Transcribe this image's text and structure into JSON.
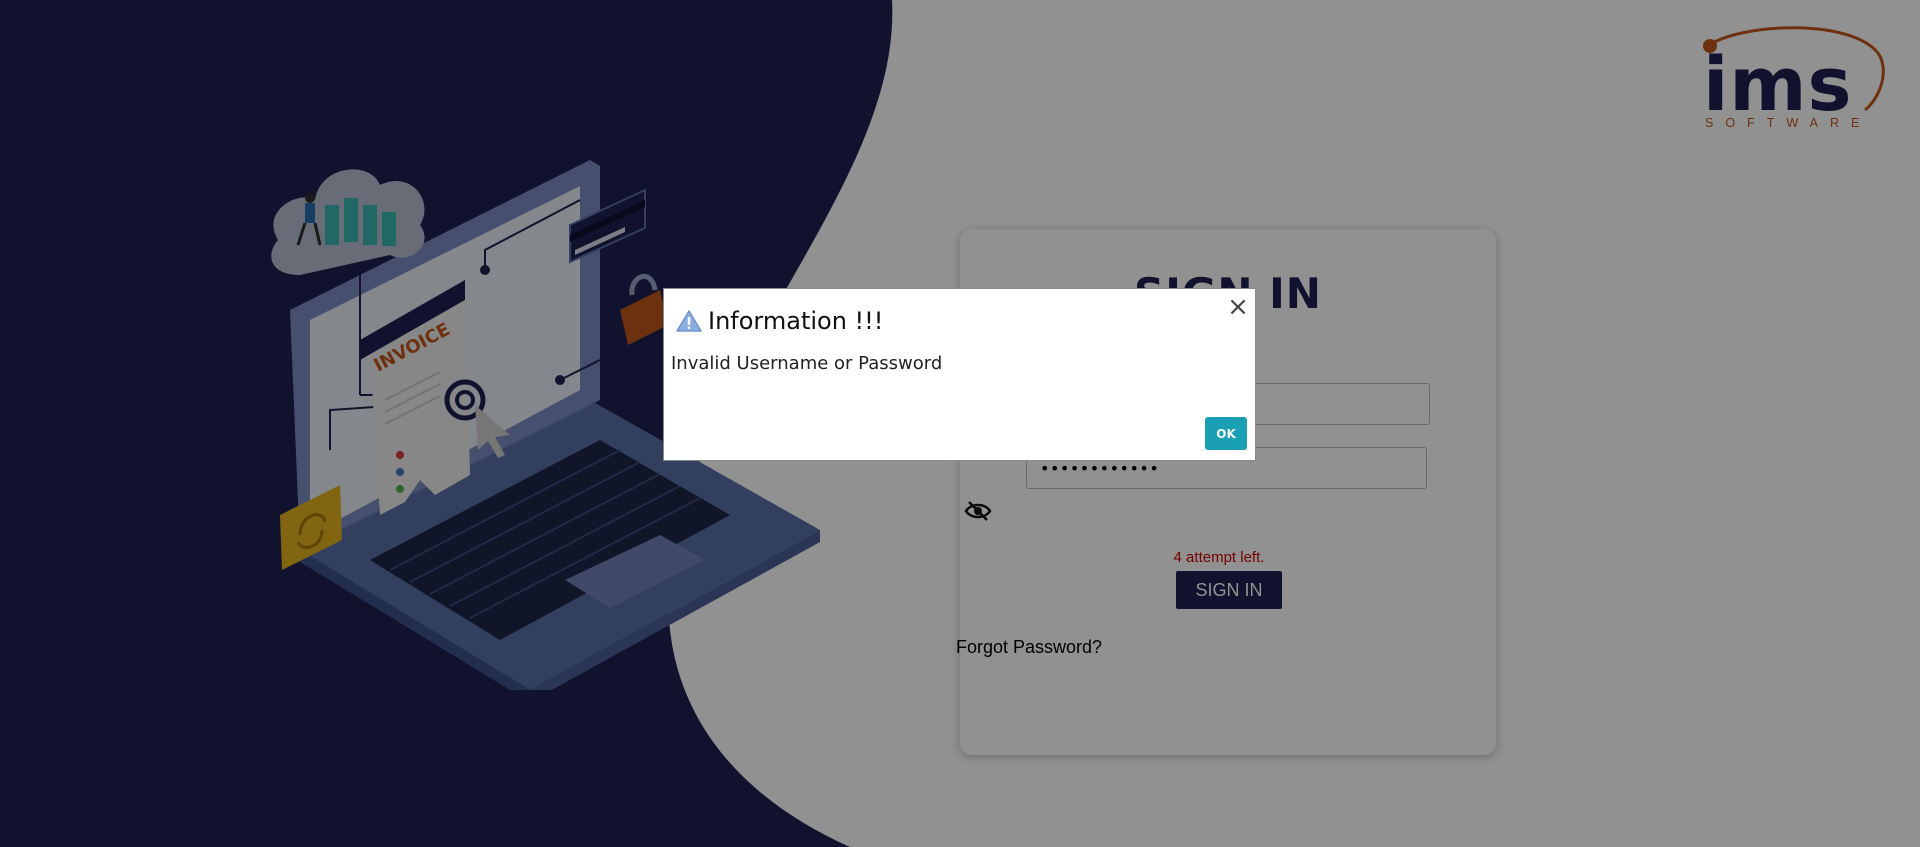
{
  "brand": {
    "logo_text": "ims",
    "logo_subtext": "SOFTWARE"
  },
  "login": {
    "title": "SIGN IN",
    "username_value": "",
    "password_masked": "••••••••••••",
    "attempts_text": "4 attempt left.",
    "signin_label": "SIGN IN",
    "forgot_label": "Forgot Password?"
  },
  "illustration": {
    "invoice_label": "INVOICE"
  },
  "dialog": {
    "title": "Information !!!",
    "message": "Invalid Username or Password",
    "ok_label": "OK",
    "close_symbol": "×"
  },
  "colors": {
    "navy": "#1e2150",
    "accent_orange": "#c2571d",
    "ok_button": "#1a9fb4",
    "error_text": "#cc0000"
  }
}
